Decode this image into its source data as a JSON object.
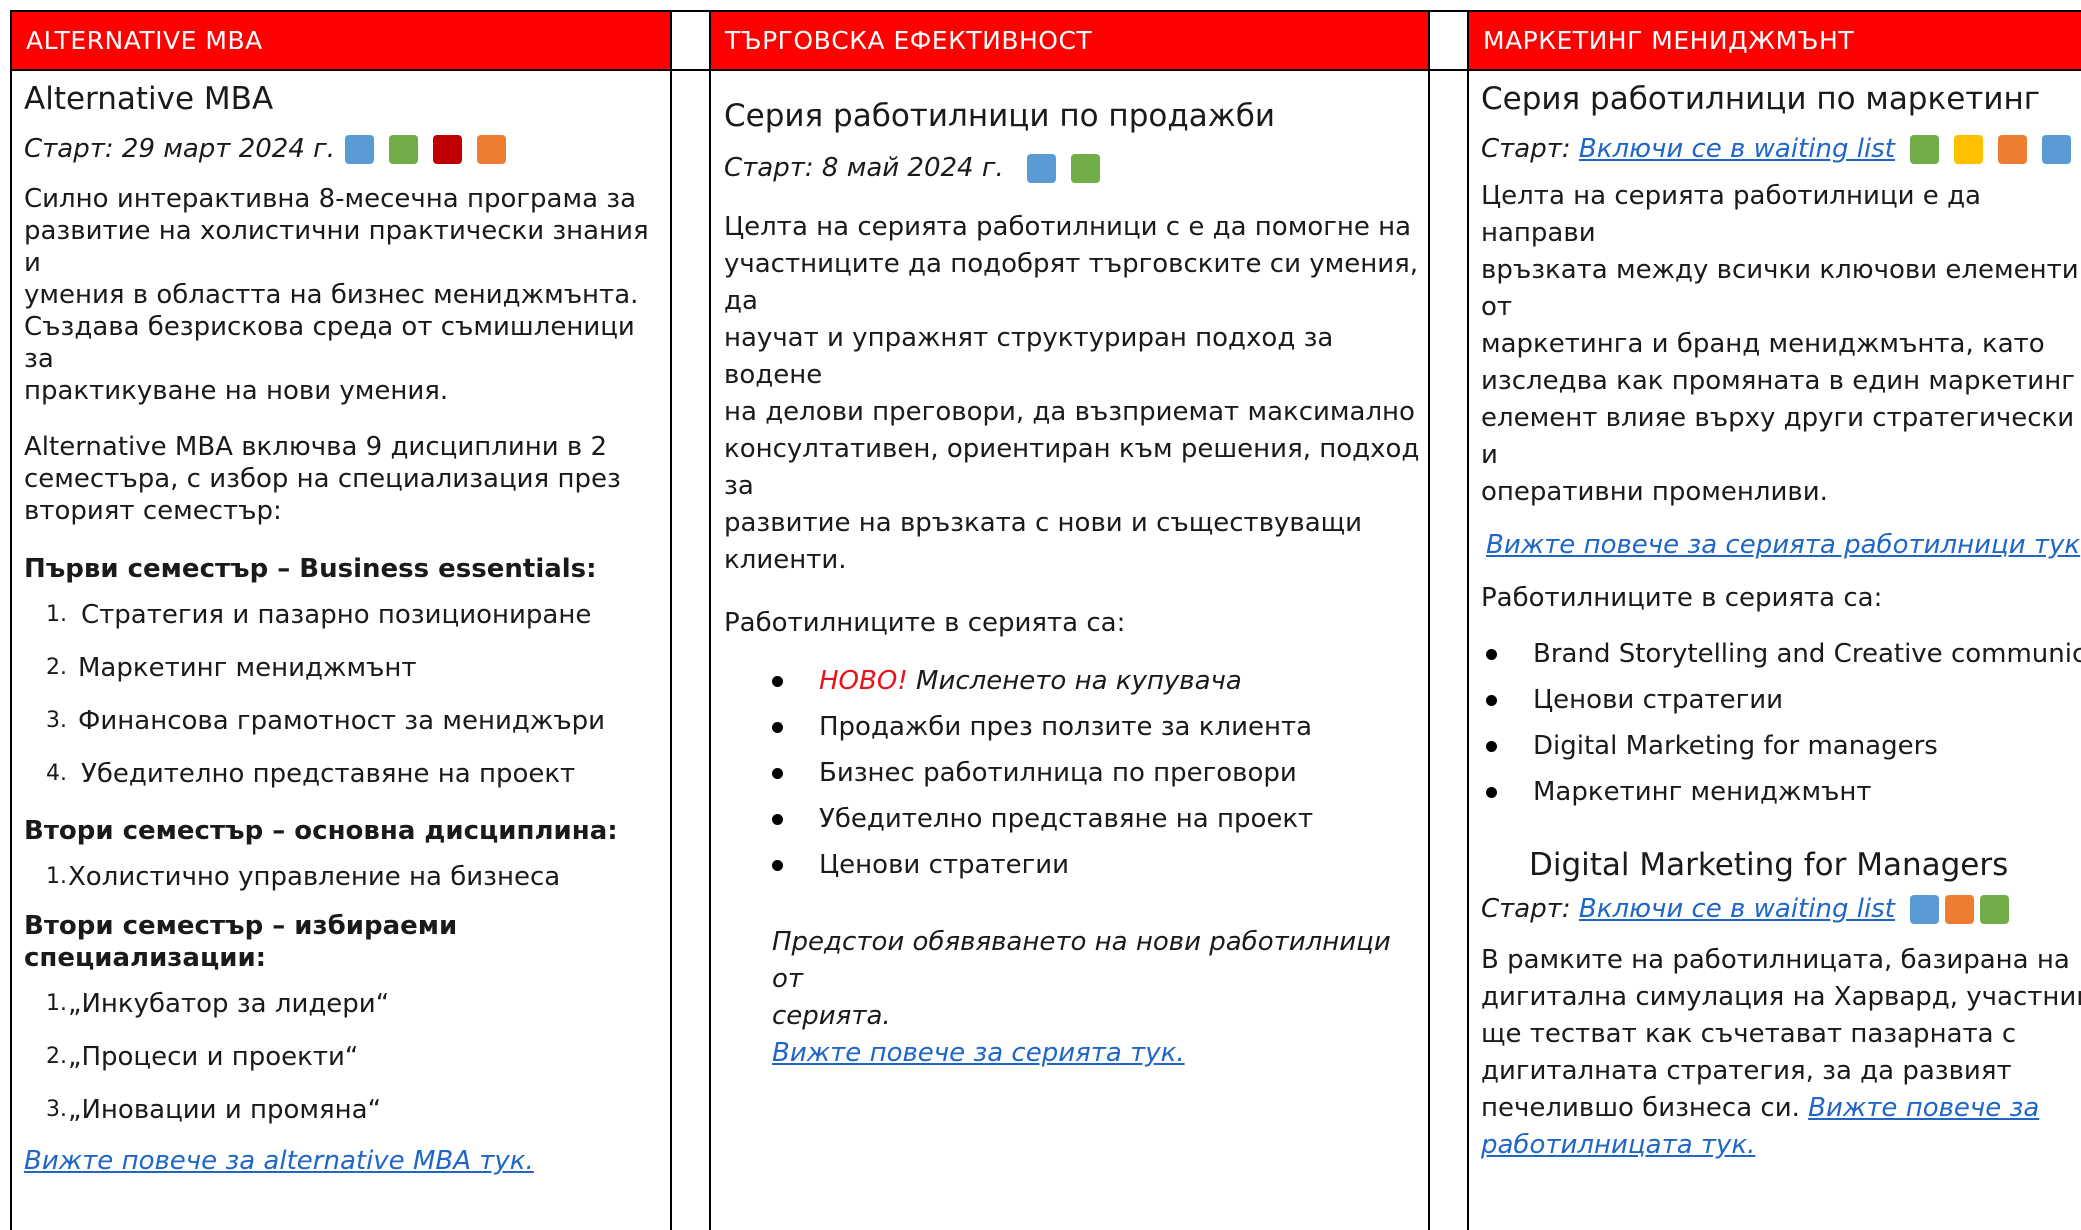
{
  "colors": {
    "header_bg": "#ff0000",
    "link": "#1f66c6",
    "new_tag": "#e8141b",
    "blue": "#5b9bd5",
    "green": "#70ad47",
    "red": "#c00000",
    "orange": "#ed7d31",
    "yellow": "#ffc000"
  },
  "col1": {
    "header": "ALTERNATIVE MBA",
    "title": "Alternative MBA",
    "start_label": "Старт: 29  март 2024 г.",
    "intro": [
      "Силно интерактивна 8-месечна програма за",
      "развитие на холистични практически знания и",
      "умения в областта на бизнес мениджмънта.",
      "Създава безрискова среда от съмишленици за",
      "практикуване на нови умения."
    ],
    "structure": [
      "Alternative MBA включва 9 дисциплини в 2",
      "семестъра, с избор на специализация през",
      "вторият семестър:"
    ],
    "sem1_heading": "Първи семестър – Business essentials:",
    "sem1": [
      {
        "num": "1.",
        "text": "Стратегия и пазарно позициониране"
      },
      {
        "num": "2.",
        "text": "Маркетинг мениджмънт"
      },
      {
        "num": "3.",
        "text": "Финансова грамотност за мениджъри"
      },
      {
        "num": "4.",
        "text": "Убедително представяне на проект"
      }
    ],
    "sem2_heading": "Втори семестър – основна дисциплина:",
    "sem2": [
      {
        "num": "1.",
        "text": "Холистично управление на бизнеса"
      }
    ],
    "sem2b_heading": "Втори семестър – избираеми специализации:",
    "sem2b": [
      {
        "num": "1.",
        "text": "„Инкубатор за лидери“"
      },
      {
        "num": "2.",
        "text": "„Процеси и проекти“"
      },
      {
        "num": "3.",
        "text": "„Иновации и промяна“"
      }
    ],
    "link": "Вижте повече за alternative MBA тук."
  },
  "col2": {
    "header": "ТЪРГОВСКА ЕФЕКТИВНОСТ",
    "title": "Серия работилници по продажби",
    "start_label": "Старт: 8 май 2024 г.",
    "intro": [
      "Целта на серията работилници с е да помогне на",
      "участниците да подобрят търговските си умения, да",
      "научат и упражнят структуриран подход за водене",
      "на делови преговори, да възприемат максимално",
      "консултативен, ориентиран към решения, подход за",
      "развитие на връзката с нови и съществуващи",
      "клиенти."
    ],
    "list_heading": "Работилниците в серията са:",
    "new_tag": "НОВО!",
    "items": [
      "Мисленето на купувача",
      "Продажби през ползите за клиента",
      "Бизнес работилница по преговори",
      "Убедително представяне на проект",
      "Ценови стратегии"
    ],
    "note": [
      "Предстои обявяването на нови работилници от",
      "серията."
    ],
    "link": "Вижте повече за серията тук."
  },
  "col3": {
    "header": "МАРКЕТИНГ МЕНИДЖМЪНТ",
    "title": "Серия работилници по маркетинг",
    "start_label": "Старт: ",
    "start_link": "Включи се в waiting list",
    "intro": [
      "Целта на серията работилници е да направи",
      "връзката между всички ключови елементи от",
      "маркетинга и бранд мениджмънта, като",
      "изследва как промяната в един маркетинг",
      "елемент влияе върху други стратегически и",
      "оперативни променливи."
    ],
    "link1": "Вижте повече за серията работилници тук",
    "list_heading": "Работилниците в серията са:",
    "items": [
      "Brand Storytelling and Creative communication",
      "Ценови стратегии",
      "Digital Marketing for managers",
      "Маркетинг мениджмънт"
    ],
    "title2": "Digital Marketing for Managers",
    "start2_label": "Старт: ",
    "start2_link": "Включи се в waiting list",
    "desc": [
      "В рамките на работилницата, базирана на",
      "дигитална симулация на Харвард, участниците",
      "ще тестват как съчетават пазарната с",
      "дигиталната стратегия, за да развият",
      "печелившо бизнеса си. "
    ],
    "link2a": "Вижте повече за",
    "link2b": "работилницата тук."
  }
}
